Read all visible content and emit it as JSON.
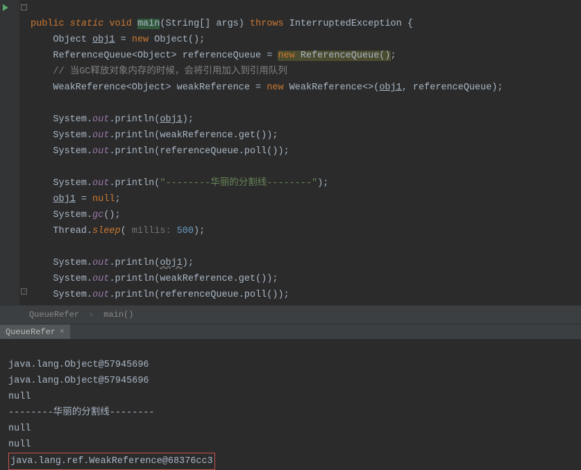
{
  "code": {
    "kw_public": "public",
    "kw_static": "static",
    "kw_void": "void",
    "main": "main",
    "sig_args": "(String[] args)",
    "kw_throws": "throws",
    "exc": "InterruptedException {",
    "l2a": "Object ",
    "obj1": "obj1",
    "l2b": " = ",
    "kw_new": "new",
    "l2c": " Object();",
    "l3a": "ReferenceQueue<Object> referenceQueue = ",
    "l3b": " ReferenceQueue()",
    "l3c": ";",
    "comment": "// 当GC释放对象内存的时候，会将引用加入到引用队列",
    "l5a": "WeakReference<Object> weakReference = ",
    "l5b": " WeakReference<>(",
    "l5c": ", referenceQueue);",
    "sys": "System.",
    "out": "out",
    "println_open": ".println(",
    "close_paren": ");",
    "wr_get": "weakReference.get()",
    "rq_poll": "referenceQueue.poll()",
    "divider_str": "\"--------华丽的分割线--------\"",
    "obj1_null_a": " = ",
    "kw_null": "null",
    "semi": ";",
    "gc": "gc",
    "gc_call": "();",
    "thread": "Thread.",
    "sleep": "sleep",
    "sleep_open": "( ",
    "millis_hint": "millis:",
    "sleep_val": " 500",
    "brace_close": "}"
  },
  "breadcrumb": {
    "class": "QueueRefer",
    "method": "main()"
  },
  "console": {
    "tab": "QueueRefer",
    "line1": "java.lang.Object@57945696",
    "line2": "java.lang.Object@57945696",
    "line3": "null",
    "line4": "--------华丽的分割线--------",
    "line5": "null",
    "line6": "null",
    "line7": "java.lang.ref.WeakReference@68376cc3"
  }
}
